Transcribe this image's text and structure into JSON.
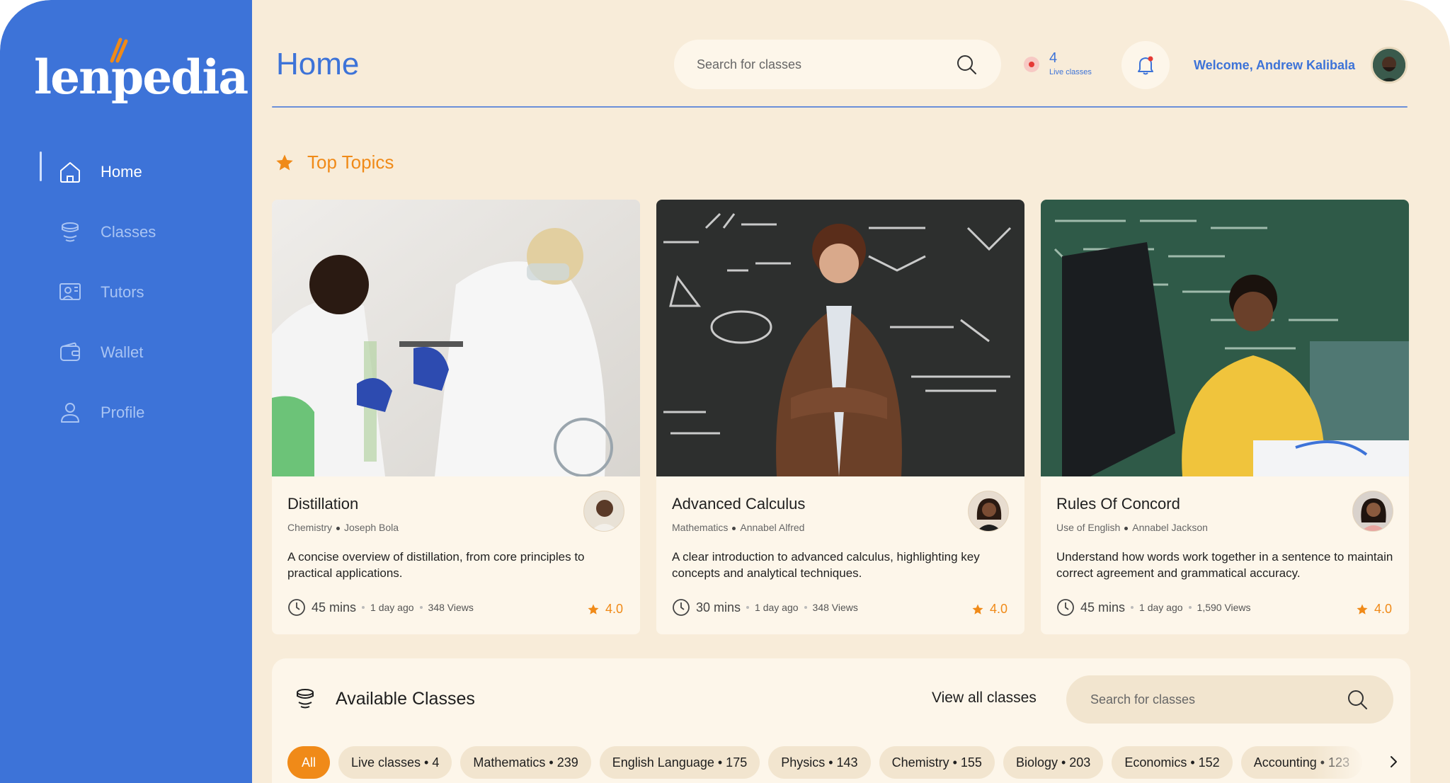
{
  "app": {
    "brand": "lenpedia",
    "colors": {
      "primary": "#3d73d8",
      "accent": "#f08a18",
      "background": "#f8ecd9",
      "card": "#fdf6ea"
    }
  },
  "sidebar": {
    "items": [
      {
        "label": "Home",
        "icon": "home-icon",
        "active": true
      },
      {
        "label": "Classes",
        "icon": "classes-icon",
        "active": false
      },
      {
        "label": "Tutors",
        "icon": "tutors-icon",
        "active": false
      },
      {
        "label": "Wallet",
        "icon": "wallet-icon",
        "active": false
      },
      {
        "label": "Profile",
        "icon": "profile-icon",
        "active": false
      }
    ]
  },
  "header": {
    "title": "Home",
    "search_placeholder": "Search for classes",
    "live_count": "4",
    "live_label": "Live classes",
    "welcome": "Welcome, Andrew Kalibala"
  },
  "top_topics": {
    "title": "Top Topics",
    "cards": [
      {
        "title": "Distillation",
        "subject": "Chemistry",
        "tutor": "Joseph Bola",
        "description": "A concise overview of distillation, from core principles to practical applications.",
        "duration": "45 mins",
        "posted": "1 day ago",
        "views": "348 Views",
        "rating": "4.0"
      },
      {
        "title": "Advanced Calculus",
        "subject": "Mathematics",
        "tutor": "Annabel Alfred",
        "description": "A clear introduction to advanced calculus, highlighting key concepts and analytical techniques.",
        "duration": "30 mins",
        "posted": "1 day ago",
        "views": "348 Views",
        "rating": "4.0"
      },
      {
        "title": "Rules Of Concord",
        "subject": "Use of English",
        "tutor": "Annabel Jackson",
        "description": "Understand how words work together in a sentence to maintain correct agreement and grammatical accuracy.",
        "duration": "45 mins",
        "posted": "1 day ago",
        "views": "1,590 Views",
        "rating": "4.0"
      }
    ]
  },
  "available_classes": {
    "title": "Available Classes",
    "view_all": "View all classes",
    "search_placeholder": "Search for classes",
    "filters": [
      "All",
      "Live  classes • 4",
      "Mathematics • 239",
      "English Language • 175",
      "Physics • 143",
      "Chemistry • 155",
      "Biology • 203",
      "Economics • 152",
      "Accounting • 123"
    ]
  }
}
